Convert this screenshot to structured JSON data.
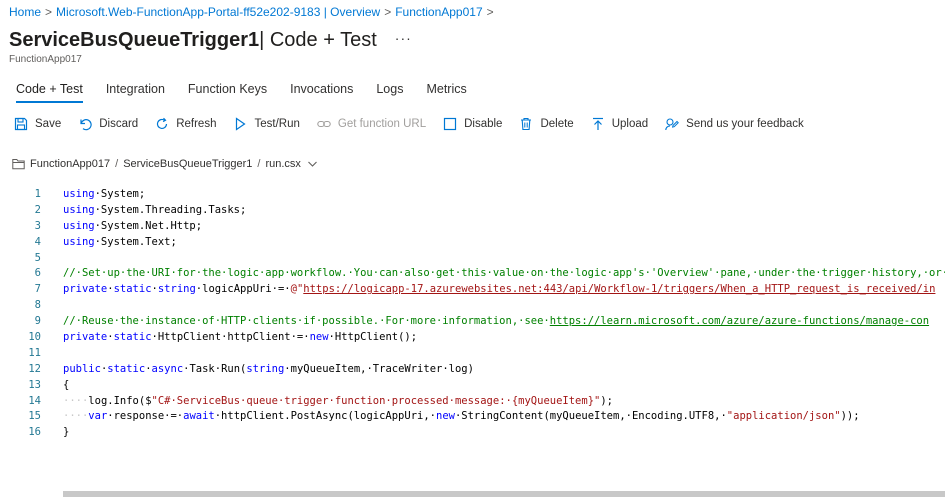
{
  "breadcrumb": {
    "items": [
      "Home",
      "Microsoft.Web-FunctionApp-Portal-ff52e202-9183 | Overview",
      "FunctionApp017"
    ],
    "separator": ">"
  },
  "header": {
    "title_main": "ServiceBusQueueTrigger1",
    "title_rest": " | Code + Test",
    "more": "···",
    "subtitle": "FunctionApp017"
  },
  "tabs": [
    {
      "label": "Code + Test",
      "active": true
    },
    {
      "label": "Integration"
    },
    {
      "label": "Function Keys"
    },
    {
      "label": "Invocations"
    },
    {
      "label": "Logs"
    },
    {
      "label": "Metrics"
    }
  ],
  "toolbar": {
    "save": "Save",
    "discard": "Discard",
    "refresh": "Refresh",
    "test_run": "Test/Run",
    "get_url": "Get function URL",
    "disable": "Disable",
    "delete": "Delete",
    "upload": "Upload",
    "feedback": "Send us your feedback"
  },
  "file_path": {
    "app": "FunctionApp017",
    "function": "ServiceBusQueueTrigger1",
    "file": "run.csx"
  },
  "code_lines": [
    {
      "n": "1",
      "segs": [
        [
          "kw",
          "using"
        ],
        [
          "",
          "·System;"
        ]
      ]
    },
    {
      "n": "2",
      "segs": [
        [
          "kw",
          "using"
        ],
        [
          "",
          "·System.Threading.Tasks;"
        ]
      ]
    },
    {
      "n": "3",
      "segs": [
        [
          "kw",
          "using"
        ],
        [
          "",
          "·System.Net.Http;"
        ]
      ]
    },
    {
      "n": "4",
      "segs": [
        [
          "kw",
          "using"
        ],
        [
          "",
          "·System.Text;"
        ]
      ]
    },
    {
      "n": "5",
      "segs": []
    },
    {
      "n": "6",
      "segs": [
        [
          "cm",
          "//·Set·up·the·URI·for·the·logic·app·workflow.·You·can·also·get·this·value·on·the·logic·app's·'Overview'·pane,·under·the·trigger·history,·or·"
        ]
      ]
    },
    {
      "n": "7",
      "segs": [
        [
          "kw",
          "private"
        ],
        [
          "",
          "·"
        ],
        [
          "kw",
          "static"
        ],
        [
          "",
          "·"
        ],
        [
          "kw",
          "string"
        ],
        [
          "",
          "·logicAppUri·=·"
        ],
        [
          "st",
          "@\""
        ],
        [
          "stl",
          "https://logicapp-17.azurewebsites.net:443/api/Workflow-1/triggers/When_a_HTTP_request_is_received/in"
        ]
      ]
    },
    {
      "n": "8",
      "segs": []
    },
    {
      "n": "9",
      "segs": [
        [
          "cm",
          "//·Reuse·the·instance·of·HTTP·clients·if·possible.·For·more·information,·see·"
        ],
        [
          "cml",
          "https://learn.microsoft.com/azure/azure-functions/manage-con"
        ]
      ]
    },
    {
      "n": "10",
      "segs": [
        [
          "kw",
          "private"
        ],
        [
          "",
          "·"
        ],
        [
          "kw",
          "static"
        ],
        [
          "",
          "·HttpClient·httpClient·=·"
        ],
        [
          "kw",
          "new"
        ],
        [
          "",
          "·HttpClient();"
        ]
      ]
    },
    {
      "n": "11",
      "segs": []
    },
    {
      "n": "12",
      "segs": [
        [
          "kw",
          "public"
        ],
        [
          "",
          "·"
        ],
        [
          "kw",
          "static"
        ],
        [
          "",
          "·"
        ],
        [
          "kw",
          "async"
        ],
        [
          "",
          "·Task·Run("
        ],
        [
          "kw",
          "string"
        ],
        [
          "",
          "·myQueueItem,·TraceWriter·log)"
        ]
      ]
    },
    {
      "n": "13",
      "segs": [
        [
          "",
          "{"
        ]
      ]
    },
    {
      "n": "14",
      "segs": [
        [
          "ws",
          "····"
        ],
        [
          "",
          "log.Info($"
        ],
        [
          "st",
          "\"C#·ServiceBus·queue·trigger·function·processed·message:·{myQueueItem}\""
        ],
        [
          "",
          ");"
        ]
      ]
    },
    {
      "n": "15",
      "segs": [
        [
          "ws",
          "····"
        ],
        [
          "kw",
          "var"
        ],
        [
          "",
          "·response·=·"
        ],
        [
          "kw",
          "await"
        ],
        [
          "",
          "·httpClient.PostAsync(logicAppUri,·"
        ],
        [
          "kw",
          "new"
        ],
        [
          "",
          "·StringContent(myQueueItem,·Encoding.UTF8,·"
        ],
        [
          "st",
          "\"application/json\""
        ],
        [
          "",
          "));"
        ]
      ]
    },
    {
      "n": "16",
      "segs": [
        [
          "",
          "}"
        ]
      ]
    }
  ],
  "colors": {
    "accent": "#0078d4",
    "keyword": "#0000ff",
    "comment": "#008000",
    "string": "#a31515",
    "line_number": "#237893"
  }
}
